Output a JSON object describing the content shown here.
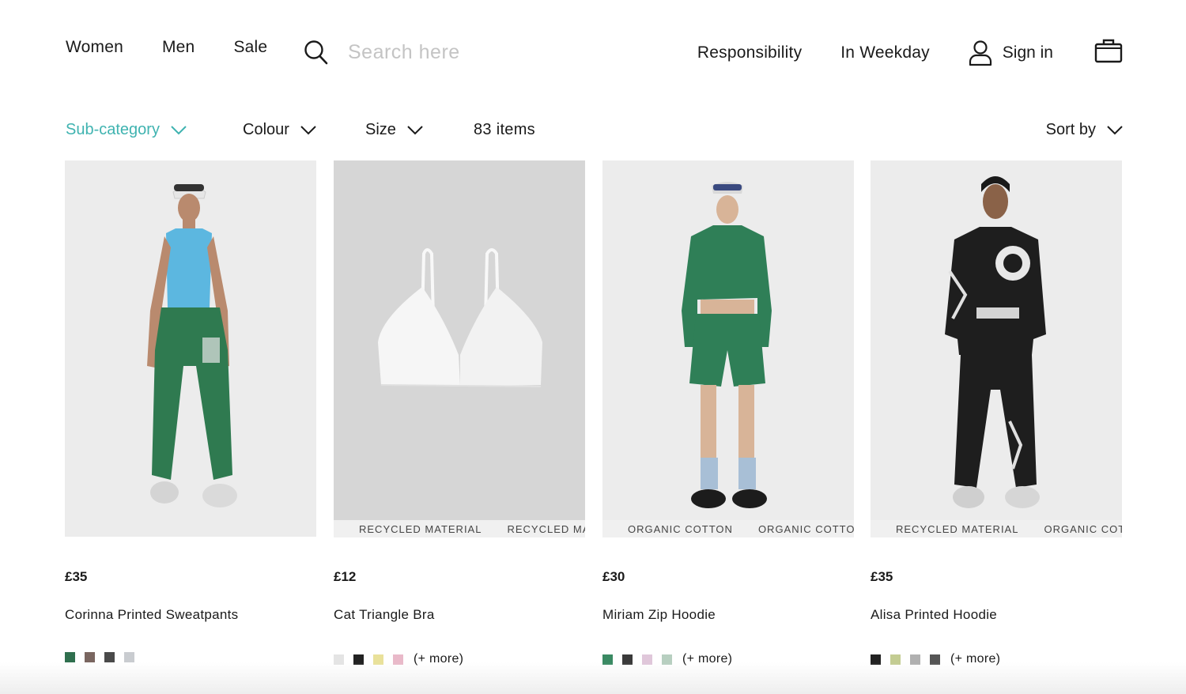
{
  "nav": {
    "women": "Women",
    "men": "Men",
    "sale": "Sale",
    "search_placeholder": "Search here",
    "responsibility": "Responsibility",
    "in_weekday": "In Weekday",
    "sign_in": "Sign in"
  },
  "filters": {
    "subcategory": "Sub-category",
    "colour": "Colour",
    "size": "Size",
    "items_count": "83 items",
    "sort_by": "Sort by",
    "active_color": "#3fb3b0"
  },
  "products": [
    {
      "price": "£35",
      "name": "Corinna Printed Sweatpants",
      "tags": [],
      "swatches": [
        "#2f6f4e",
        "#7a6660",
        "#4a4a4a",
        "#c9ccd0"
      ],
      "more": ""
    },
    {
      "price": "£12",
      "name": "Cat Triangle Bra",
      "tags": [
        "RECYCLED MATERIAL",
        "RECYCLED MA"
      ],
      "swatches": [
        "#e4e4e4",
        "#222222",
        "#e9e19a",
        "#e9b9c9"
      ],
      "more": "(+ more)"
    },
    {
      "price": "£30",
      "name": "Miriam Zip Hoodie",
      "tags": [
        "ORGANIC COTTON",
        "ORGANIC COTTOI"
      ],
      "swatches": [
        "#3a8a63",
        "#3a3a3a",
        "#e0c7da",
        "#b7cfc0"
      ],
      "more": "(+ more)"
    },
    {
      "price": "£35",
      "name": "Alisa Printed Hoodie",
      "tags": [
        "RECYCLED MATERIAL",
        "ORGANIC COTTO"
      ],
      "swatches": [
        "#222222",
        "#c3cc92",
        "#b0b0b0",
        "#555555"
      ],
      "more": "(+ more)"
    }
  ]
}
